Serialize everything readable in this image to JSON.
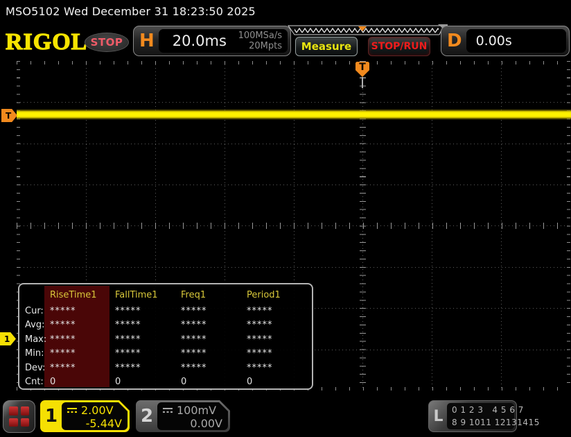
{
  "header": {
    "title": "MSO5102  Wed December 31 18:23:50 2025"
  },
  "toolbar": {
    "brand": "RIGOL",
    "run_status": "STOP",
    "h_label": "H",
    "timebase": "20.0ms",
    "sample_rate": "100MSa/s",
    "memory_depth": "20Mpts",
    "measure_label": "Measure",
    "stoprun_label": "STOP/RUN",
    "d_label": "D",
    "delay": "0.00s"
  },
  "markers": {
    "trigger_level_label": "T",
    "trigger_position_label": "T",
    "ch1_ground_label": "1"
  },
  "measure_table": {
    "selected_column": "RiseTime1",
    "columns": [
      "RiseTime1",
      "FallTime1",
      "Freq1",
      "Period1"
    ],
    "rows": [
      {
        "label": "Cur:",
        "values": [
          "*****",
          "*****",
          "*****",
          "*****"
        ]
      },
      {
        "label": "Avg:",
        "values": [
          "*****",
          "*****",
          "*****",
          "*****"
        ]
      },
      {
        "label": "Max:",
        "values": [
          "*****",
          "*****",
          "*****",
          "*****"
        ]
      },
      {
        "label": "Min:",
        "values": [
          "*****",
          "*****",
          "*****",
          "*****"
        ]
      },
      {
        "label": "Dev:",
        "values": [
          "*****",
          "*****",
          "*****",
          "*****"
        ]
      },
      {
        "label": "Cnt:",
        "values": [
          "0",
          "0",
          "0",
          "0"
        ]
      }
    ]
  },
  "channels": {
    "ch1": {
      "number": "1",
      "coupling": "DC",
      "scale": "2.00V",
      "offset": "-5.44V"
    },
    "ch2": {
      "number": "2",
      "coupling": "DC",
      "scale": "100mV",
      "offset": "0.00V"
    }
  },
  "logic": {
    "label": "L",
    "line1": "0 1 2 3   4 5 6 7",
    "line2": "8 9 1011 12131415"
  },
  "colors": {
    "ch1_yellow": "#f5e003",
    "ch2_gray": "#a9a9a9",
    "trigger_orange": "#f28a1e",
    "stop_badge_red": "#ef5b68",
    "stoprun_red": "#ee1c1c",
    "measure_yellow": "#e8e310",
    "table_selected_col": "#4a0607",
    "waveform_yellow": "#fff200"
  }
}
